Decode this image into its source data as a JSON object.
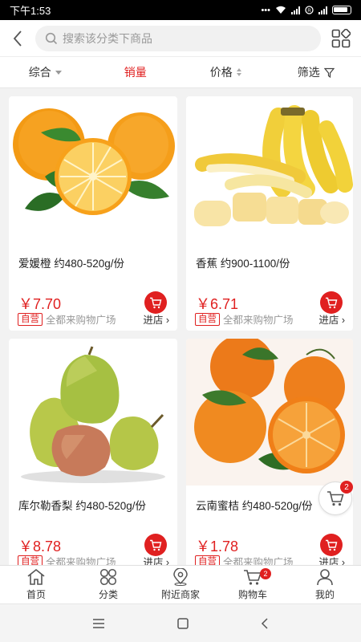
{
  "status": {
    "time": "下午1:53"
  },
  "search": {
    "placeholder": "搜索该分类下商品"
  },
  "filters": [
    {
      "label": "综合"
    },
    {
      "label": "销量"
    },
    {
      "label": "价格"
    },
    {
      "label": "筛选"
    }
  ],
  "products": [
    {
      "name": "爱媛橙 约480-520g/份",
      "price": "￥7.70",
      "tag": "自营",
      "store": "全都来购物广场",
      "enter": "进店"
    },
    {
      "name": "香蕉 约900-1100/份",
      "price": "￥6.71",
      "tag": "自营",
      "store": "全都来购物广场",
      "enter": "进店"
    },
    {
      "name": "库尔勒香梨 约480-520g/份",
      "price": "￥8.78",
      "tag": "自营",
      "store": "全都来购物广场",
      "enter": "进店"
    },
    {
      "name": "云南蜜桔 约480-520g/份",
      "price": "￥1.78",
      "tag": "自营",
      "store": "全都来购物广场",
      "enter": "进店"
    }
  ],
  "float_cart": {
    "count": "2"
  },
  "nav": [
    {
      "label": "首页"
    },
    {
      "label": "分类"
    },
    {
      "label": "附近商家"
    },
    {
      "label": "购物车",
      "badge": "2"
    },
    {
      "label": "我的"
    }
  ],
  "colors": {
    "accent": "#e02020",
    "background": "#f2f2f2"
  }
}
